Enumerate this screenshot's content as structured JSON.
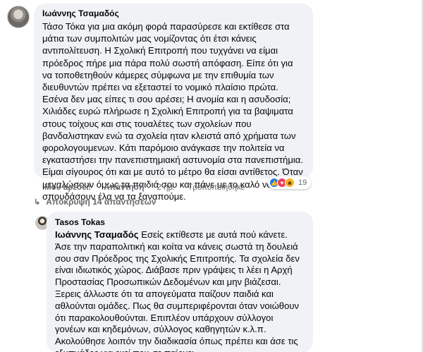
{
  "comment": {
    "author": "Ιωάννης Τσαμαδός",
    "text": "Τάσο Τόκα για μια ακόμη φορά παρασύρεσε και εκτίθεσε στα μάτια των συμπολιτών μας νομίζοντας ότι έτσι κάνεις αντιπολίτευση. Η Σχολική Επιτροπή που τυχγάνει να είμαι πρόεδρος πήρε μια πάρα πολύ σωστή απόφαση. Είπε ότι για να τοποθετηθούν κάμερες σύμφωνα με την επιθυμία των διευθυντών πρέπει να εξεταστεί το νομικό πλαίσιο πρώτα. Εσένα δεν μας είπες τι σου αρέσει; Η ανομία και η ασυδοσία; Χιλιάδες ευρώ πλήρωσε η Σχολική Επιτροπή για τα βαψιματα στους τοίχους και στις τουαλέτες των σχολείων που βανδαλιστηκαν ενώ τα σχολεία ηταν κλειστά από χρήματα των φορολογουμενων. Κάτι παρόμοιο ανάγκασε την πολιτεία να εγκαταστήσει την πανεπιστημιακή αστυνομία στα πανεπιστήμια. Είμαι σίγουρος ότι και με αυτό το μέτρο θα είσαι αντίθετος. Όταν μεγαλώσουν όμως τα παιδιά σου και πάνε με το καλό να σπουδάσουν έλα να τα ξαναπούμε.",
    "actions": {
      "like": "Μου αρέσει!",
      "reply": "Απάντηση",
      "time": "2 ημ.",
      "edited": "Τροποποιήθηκε"
    },
    "reactions": {
      "icons": [
        "like-icon",
        "love-icon",
        "haha-icon"
      ],
      "count": "19"
    }
  },
  "replies_toggle": {
    "label": "Απόκρυψη 14 απαντήσεων"
  },
  "reply": {
    "author": "Tasos Tokas",
    "mention": "Ιωάννης Τσαμαδός",
    "text": " Εσείς εκτίθεστε με αυτά πού κάνετε. Άσε την παραπολιτική και κοίτα να κάνεις σωστά τη δουλειά σου σαν Πρόεδρος της Σχολικής Επιτροπής. Τα σχολεία δεν είναι ιδιωτικός χώρος. Διάβασε πριν γράψεις τι λέει η Αρχή Προστασίας Προσωπικών Δεδομένων και μην βιάζεσαι. Ξερεις άλλωστε ότι τα απογεύματα παίζουν παιδιά και αθλούνται ομάδες. Πως θα συμπεριφέρονται όταν νοιώθουν ότι παρακολουθούνται. Επιπλέον υπάρχουν σύλλογοι γονέων και κηδεμόνων, σύλλογος καθηγητών κ.λ.π. Ακολούθησε λοιπόν την διαδικασία όπως πρέπει και άσε τις εξυπνάδες για εκεί που σε παίρνει."
  }
}
